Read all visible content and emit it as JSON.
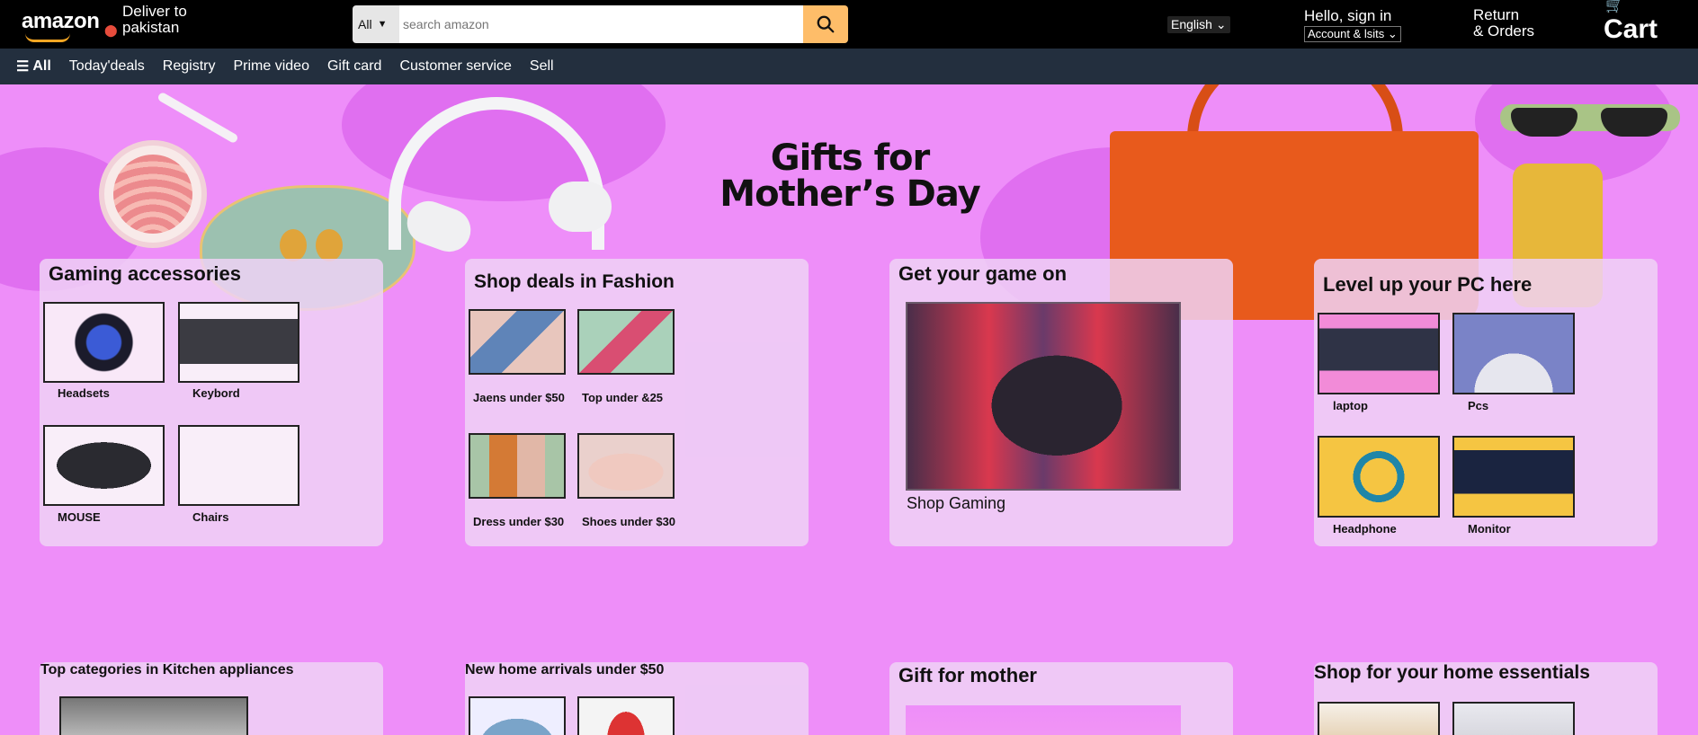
{
  "header": {
    "logo": "amazon",
    "deliver_line1": "Deliver to",
    "deliver_line2": "pakistan",
    "search_category": "All",
    "search_placeholder": "search amazon",
    "language": "English",
    "signin_line1": "Hello, sign in",
    "signin_line2": "Account & lsits",
    "returns_line1": "Return",
    "returns_line2": "& Orders",
    "cart_label": "Cart"
  },
  "subnav": {
    "all": "All",
    "items": [
      "Today'deals",
      "Registry",
      "Prime video",
      "Gift card",
      "Customer service",
      "Sell"
    ]
  },
  "hero": {
    "title_line1": "Gifts for",
    "title_line2": "Mother’s Day"
  },
  "cards": [
    {
      "title": "Gaming accessories",
      "tiles": [
        "Headsets",
        "Keybord",
        "MOUSE",
        "Chairs"
      ]
    },
    {
      "title": "Shop deals in Fashion",
      "tiles": [
        "Jaens under $50",
        "Top under &25",
        "Dress under $30",
        "Shoes under $30"
      ]
    },
    {
      "title": "Get your game on",
      "link": "Shop Gaming"
    },
    {
      "title": "Level up your PC here",
      "tiles": [
        "laptop",
        "Pcs",
        "Headphone",
        "Monitor"
      ]
    }
  ],
  "cards_row2": [
    {
      "title": "Top categories in Kitchen appliances"
    },
    {
      "title": "New home arrivals under $50"
    },
    {
      "title": "Gift for mother"
    },
    {
      "title": "Shop for your home essentials"
    }
  ],
  "colors": {
    "topbar": "#000000",
    "subnav": "#232f3e",
    "search_button": "#febd69",
    "hero_bg": "#ee8ef9"
  }
}
